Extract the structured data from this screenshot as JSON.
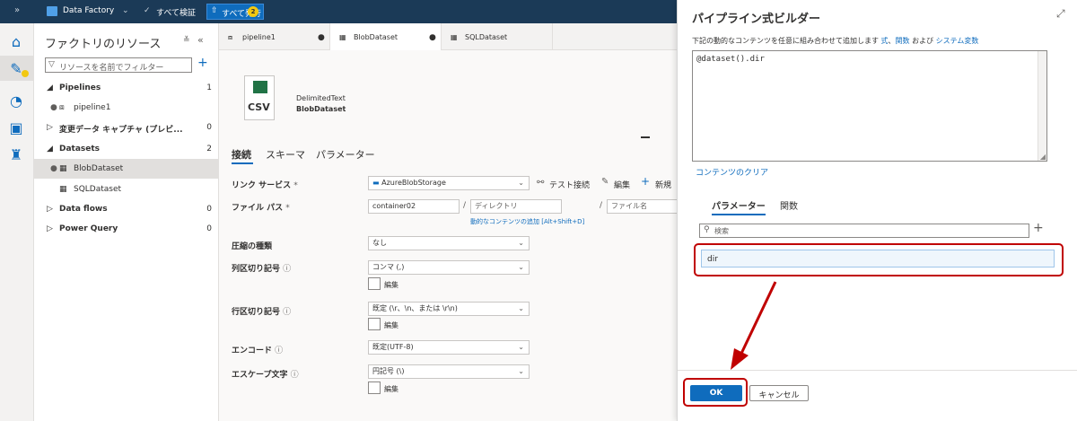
{
  "topbar": {
    "collapse_glyph": "»",
    "factory_name": "Data Factory",
    "validate_all": "すべて検証",
    "publish_all": "すべて発行",
    "publish_count": "2"
  },
  "resources": {
    "title": "ファクトリのリソース",
    "filter_placeholder": "リソースを名前でフィルター",
    "pipelines": {
      "label": "Pipelines",
      "count": "1"
    },
    "pipeline1": "pipeline1",
    "cdc": {
      "label": "変更データ キャプチャ (プレビ...",
      "count": "0"
    },
    "datasets": {
      "label": "Datasets",
      "count": "2"
    },
    "blob_dataset": "BlobDataset",
    "sql_dataset": "SQLDataset",
    "dataflows": {
      "label": "Data flows",
      "count": "0"
    },
    "powerquery": {
      "label": "Power Query",
      "count": "0"
    }
  },
  "tabs": [
    "pipeline1",
    "BlobDataset",
    "SQLDataset"
  ],
  "dataset": {
    "icon_text": "CSV",
    "type": "DelimitedText",
    "name": "BlobDataset",
    "subtabs": [
      "接続",
      "スキーマ",
      "パラメーター"
    ]
  },
  "form": {
    "linked_service_label": "リンク サービス",
    "linked_service_value": "AzureBlobStorage",
    "test_connection": "テスト接続",
    "edit": "編集",
    "new": "新規",
    "filepath_label": "ファイル パス",
    "container_value": "container02",
    "directory_placeholder": "ディレクトリ",
    "filename_placeholder": "ファイル名",
    "dynamic_content_link": "動的なコンテンツの追加 [Alt+Shift+D]",
    "compression_label": "圧縮の種類",
    "compression_value": "なし",
    "column_delim_label": "列区切り記号",
    "column_delim_value": "コンマ (,)",
    "edit_checkbox": "編集",
    "row_delim_label": "行区切り記号",
    "row_delim_value": "既定 (\\r、\\n、または \\r\\n)",
    "encoding_label": "エンコード",
    "encoding_value": "既定(UTF-8)",
    "escape_label": "エスケープ文字",
    "escape_value": "円記号 (\\)",
    "required_mark": "*",
    "info_mark": "ⓘ"
  },
  "builder": {
    "title": "パイプライン式ビルダー",
    "expand_glyph": "⤢",
    "desc_prefix": "下記の動的なコンテンツを任意に組み合わせて追加します",
    "link_expr": "式",
    "link_func": "関数",
    "desc_and": "および",
    "link_sysvars": "システム変数",
    "expression": "@dataset().dir",
    "clear_content": "コンテンツのクリア",
    "tab_params": "パラメーター",
    "tab_funcs": "関数",
    "search_placeholder": "検索",
    "param_item": "dir",
    "ok": "OK",
    "cancel": "キャンセル"
  },
  "colors": {
    "topbar": "#1b3a57",
    "accent": "#0f6cbd",
    "highlight_red": "#c00000",
    "selected_row": "#e1dfdd"
  }
}
